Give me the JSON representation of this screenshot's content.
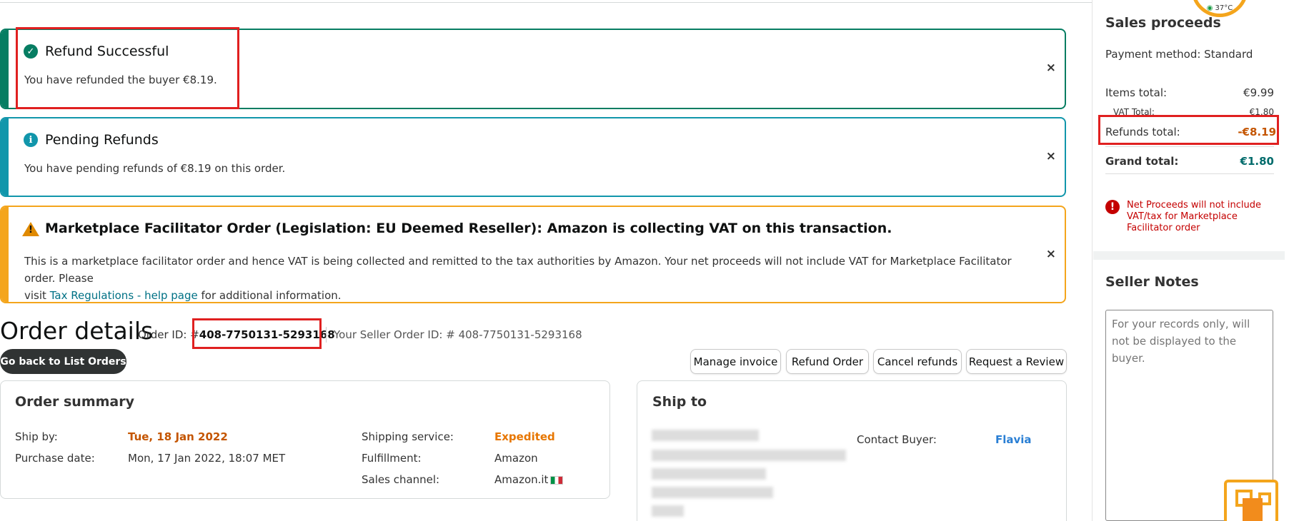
{
  "alerts": {
    "success": {
      "title": "Refund Successful",
      "body": "You have refunded the buyer €8.19.",
      "close": "×"
    },
    "info": {
      "title": "Pending Refunds",
      "body": "You have pending refunds of €8.19 on this order.",
      "close": "×"
    },
    "warning": {
      "title": "Marketplace Facilitator Order (Legislation: EU Deemed Reseller): Amazon is collecting VAT on this transaction.",
      "body_line1": "This is a marketplace facilitator order and hence VAT is being collected and remitted to the tax authorities by Amazon. Your net proceeds will not include VAT for Marketplace Facilitator order. Please",
      "body_prefix": "visit",
      "body_link": "Tax Regulations - help page",
      "body_suffix": "for additional information.",
      "close": "×"
    }
  },
  "order": {
    "title": "Order details",
    "id_label": "Order ID: #",
    "id": "408-7750131-5293168",
    "seller_order": "Your Seller Order ID: # 408-7750131-5293168",
    "back_button": "Go back to List Orders",
    "actions": [
      "Manage invoice",
      "Refund Order",
      "Cancel refunds",
      "Request a Review"
    ]
  },
  "summary": {
    "title": "Order summary",
    "ship_by_label": "Ship by:",
    "ship_by": "Tue, 18 Jan 2022",
    "purchase_label": "Purchase date:",
    "purchase": "Mon, 17 Jan 2022, 18:07 MET",
    "shipping_label": "Shipping service:",
    "shipping": "Expedited",
    "fulfillment_label": "Fulfillment:",
    "fulfillment": "Amazon",
    "channel_label": "Sales channel:",
    "channel": "Amazon.it"
  },
  "ship_to": {
    "title": "Ship to",
    "contact_label": "Contact Buyer:",
    "contact_name": "Flavia"
  },
  "proceeds": {
    "title": "Sales proceeds",
    "payment_method": "Payment method: Standard",
    "items_label": "Items total:",
    "items": "€9.99",
    "vat_label": "VAT Total:",
    "vat": "€1.80",
    "refunds_label": "Refunds total:",
    "refunds": "-€8.19",
    "grand_label": "Grand total:",
    "grand": "€1.80",
    "note": "Net Proceeds will not include VAT/tax for Marketplace Facilitator order"
  },
  "notes": {
    "title": "Seller Notes",
    "placeholder": "For your records only, will not be displayed to the buyer."
  },
  "weather": {
    "temp": "37°C"
  },
  "colors": {
    "success": "#067d62",
    "info": "#1196ab",
    "warning": "#f4a51c",
    "accent_orange": "#e77600",
    "link": "#007185",
    "highlight": "#e02020"
  }
}
